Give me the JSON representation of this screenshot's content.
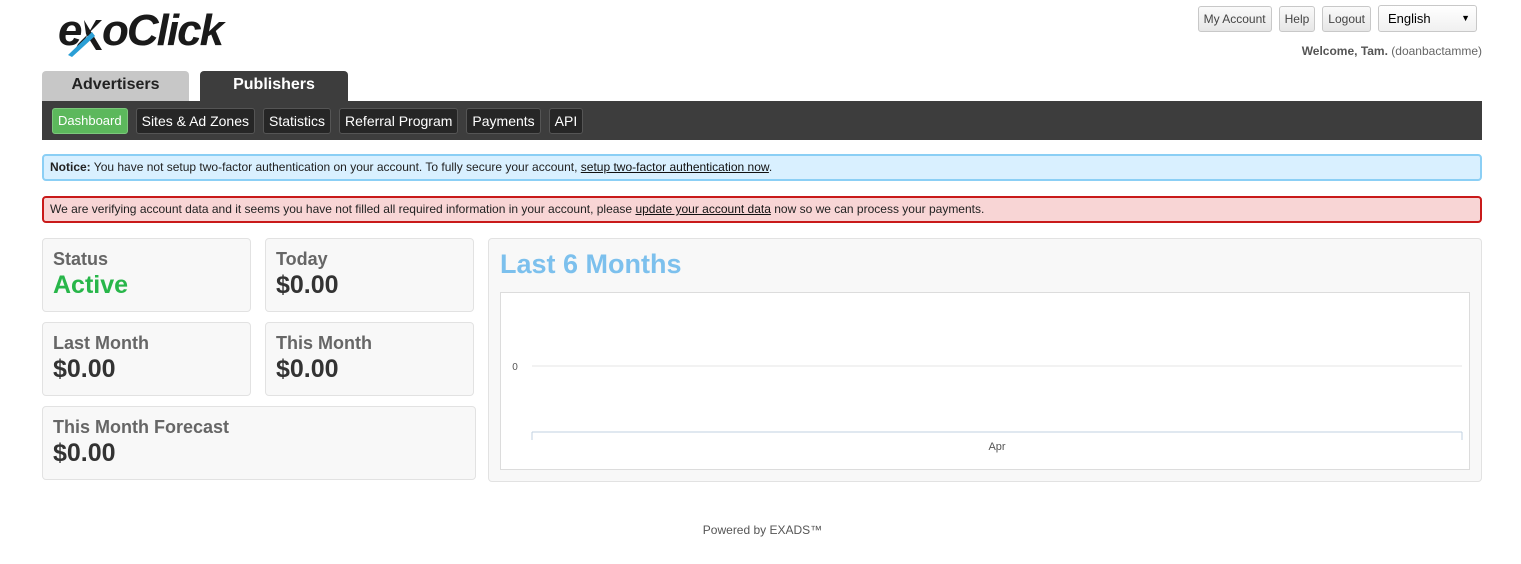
{
  "brand": {
    "logo_text": "exoClick"
  },
  "top_links": {
    "my_account": "My Account",
    "help": "Help",
    "logout": "Logout"
  },
  "language": {
    "selected": "English"
  },
  "welcome": {
    "greeting": "Welcome, Tam.",
    "username": "(doanbactamme)"
  },
  "tabs": [
    {
      "label": "Advertisers",
      "active": false
    },
    {
      "label": "Publishers",
      "active": true
    }
  ],
  "subnav": [
    {
      "label": "Dashboard",
      "active": true
    },
    {
      "label": "Sites & Ad Zones",
      "active": false
    },
    {
      "label": "Statistics",
      "active": false
    },
    {
      "label": "Referral Program",
      "active": false
    },
    {
      "label": "Payments",
      "active": false
    },
    {
      "label": "API",
      "active": false
    }
  ],
  "notice": {
    "prefix": "Notice:",
    "text": " You have not setup two-factor authentication on your account. To fully secure your account, ",
    "link": "setup two-factor authentication now",
    "suffix": "."
  },
  "warning": {
    "text": "We are verifying account data and it seems you have not filled all required information in your account, please ",
    "link": "update your account data",
    "suffix": " now so we can process your payments."
  },
  "stats": {
    "status": {
      "label": "Status",
      "value": "Active"
    },
    "today": {
      "label": "Today",
      "value": "$0.00"
    },
    "last_month": {
      "label": "Last Month",
      "value": "$0.00"
    },
    "this_month": {
      "label": "This Month",
      "value": "$0.00"
    },
    "forecast": {
      "label": "This Month Forecast",
      "value": "$0.00"
    }
  },
  "chart_title": "Last 6 Months",
  "chart_data": {
    "type": "line",
    "title": "Last 6 Months",
    "x": [
      "Apr"
    ],
    "series": [
      {
        "values": [
          0
        ]
      }
    ],
    "ylim": [
      0,
      0
    ],
    "y_ticks": [
      "0"
    ],
    "grid": true,
    "xlabel": "",
    "ylabel": ""
  },
  "footer": "Powered by EXADS™",
  "colors": {
    "accent_green": "#5cb85c",
    "active_green": "#28b64a",
    "chart_title_blue": "#7cc0ed",
    "nav_dark": "#3d3d3d"
  }
}
